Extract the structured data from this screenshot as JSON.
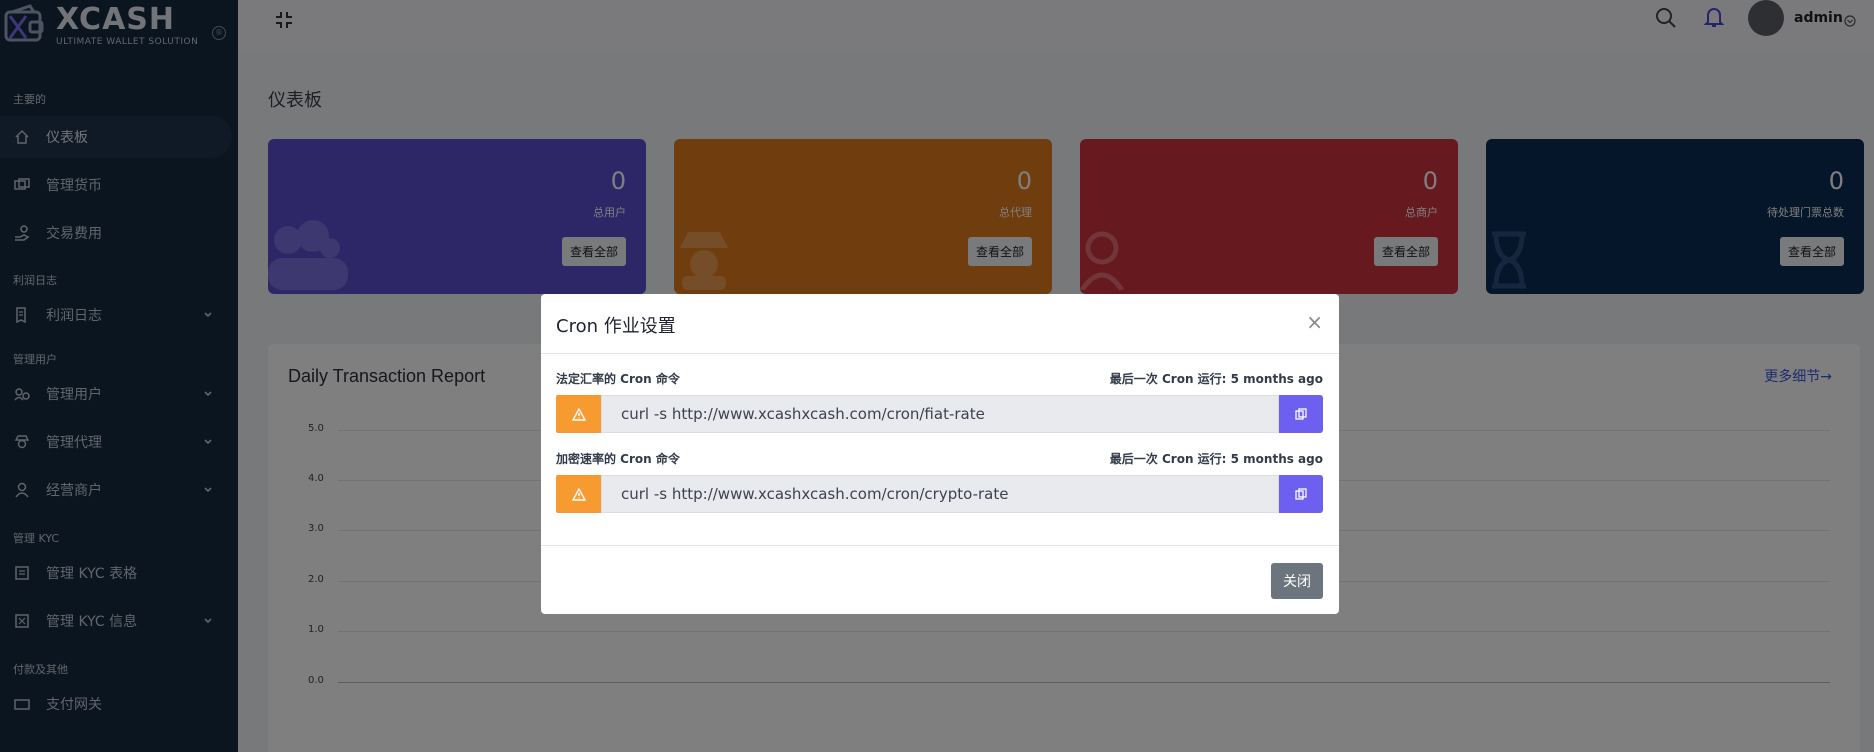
{
  "brand": {
    "name": "XCASH",
    "tagline": "ULTIMATE WALLET SOLUTION",
    "registered": "®"
  },
  "sidebar": {
    "sections": [
      {
        "title": "主要的",
        "items": [
          {
            "label": "仪表板",
            "icon": "home-icon",
            "active": true
          },
          {
            "label": "管理货币",
            "icon": "money-icon"
          },
          {
            "label": "交易费用",
            "icon": "hand-coin-icon"
          }
        ]
      },
      {
        "title": "利润日志",
        "items": [
          {
            "label": "利润日志",
            "icon": "receipt-icon",
            "has_children": true
          }
        ]
      },
      {
        "title": "管理用户",
        "items": [
          {
            "label": "管理用户",
            "icon": "users-gear-icon",
            "has_children": true
          },
          {
            "label": "管理代理",
            "icon": "agent-icon",
            "has_children": true
          },
          {
            "label": "经营商户",
            "icon": "user-icon",
            "has_children": true
          }
        ]
      },
      {
        "title": "管理 KYC",
        "items": [
          {
            "label": "管理 KYC 表格",
            "icon": "form-icon"
          },
          {
            "label": "管理 KYC 信息",
            "icon": "id-card-icon",
            "has_children": true
          }
        ]
      },
      {
        "title": "付款及其他",
        "items": [
          {
            "label": "支付网关",
            "icon": "gateway-icon"
          }
        ]
      }
    ]
  },
  "topbar": {
    "user_name": "admin"
  },
  "page": {
    "title": "仪表板"
  },
  "stats": [
    {
      "value": "0",
      "label": "总用户",
      "button": "查看全部",
      "color": "#5a4fd0"
    },
    {
      "value": "0",
      "label": "总代理",
      "button": "查看全部",
      "color": "#e07a1d"
    },
    {
      "value": "0",
      "label": "总商户",
      "button": "查看全部",
      "color": "#cf3341"
    },
    {
      "value": "0",
      "label": "待处理门票总数",
      "button": "查看全部",
      "color": "#0a2d57"
    }
  ],
  "report": {
    "title": "Daily Transaction Report",
    "more_link": "更多细节→",
    "yticks": [
      "5.0",
      "4.0",
      "3.0",
      "2.0",
      "1.0",
      "0.0"
    ]
  },
  "modal": {
    "title": "Cron 作业设置",
    "close_symbol": "×",
    "rows": [
      {
        "label": "法定汇率的 Cron 命令",
        "last_run_label": "最后一次 Cron 运行: 5 months ago",
        "command": "curl -s http://www.xcashxcash.com/cron/fiat-rate"
      },
      {
        "label": "加密速率的 Cron 命令",
        "last_run_label": "最后一次 Cron 运行: 5 months ago",
        "command": "curl -s http://www.xcashxcash.com/cron/crypto-rate"
      }
    ],
    "close_button": "关闭"
  },
  "colors": {
    "sidebar_bg": "#142a41",
    "warning": "#f79a2f",
    "copy_button": "#6d5ff0",
    "accent_link": "#3e56d9"
  }
}
